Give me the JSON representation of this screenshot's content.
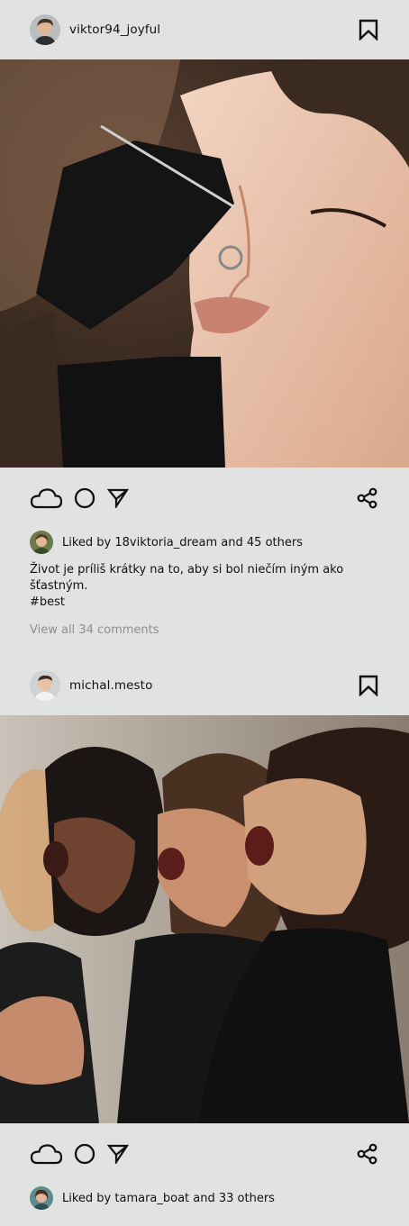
{
  "posts": [
    {
      "username": "viktor94_joyful",
      "likes_text": "Liked by 18viktoria_dream and 45 others",
      "caption_line1": "Život je príliš krátky na to, aby si bol niečím iným ako šťastným.",
      "caption_line2": "#best",
      "comments_link": "View all 34 comments",
      "photo_subject": "piercing-closeup",
      "icons": {
        "like": "cloud-icon",
        "comment": "circle-icon",
        "share": "send-icon",
        "more_share": "share-nodes-icon",
        "save": "bookmark-icon"
      }
    },
    {
      "username": "michal.mesto",
      "likes_text": "Liked by tamara_boat and 33 others",
      "photo_subject": "choir-singers",
      "icons": {
        "like": "cloud-icon",
        "comment": "circle-icon",
        "share": "send-icon",
        "more_share": "share-nodes-icon",
        "save": "bookmark-icon"
      }
    }
  ],
  "colors": {
    "background": "#e1e3e2",
    "text": "#111111",
    "muted": "#8d9090"
  }
}
